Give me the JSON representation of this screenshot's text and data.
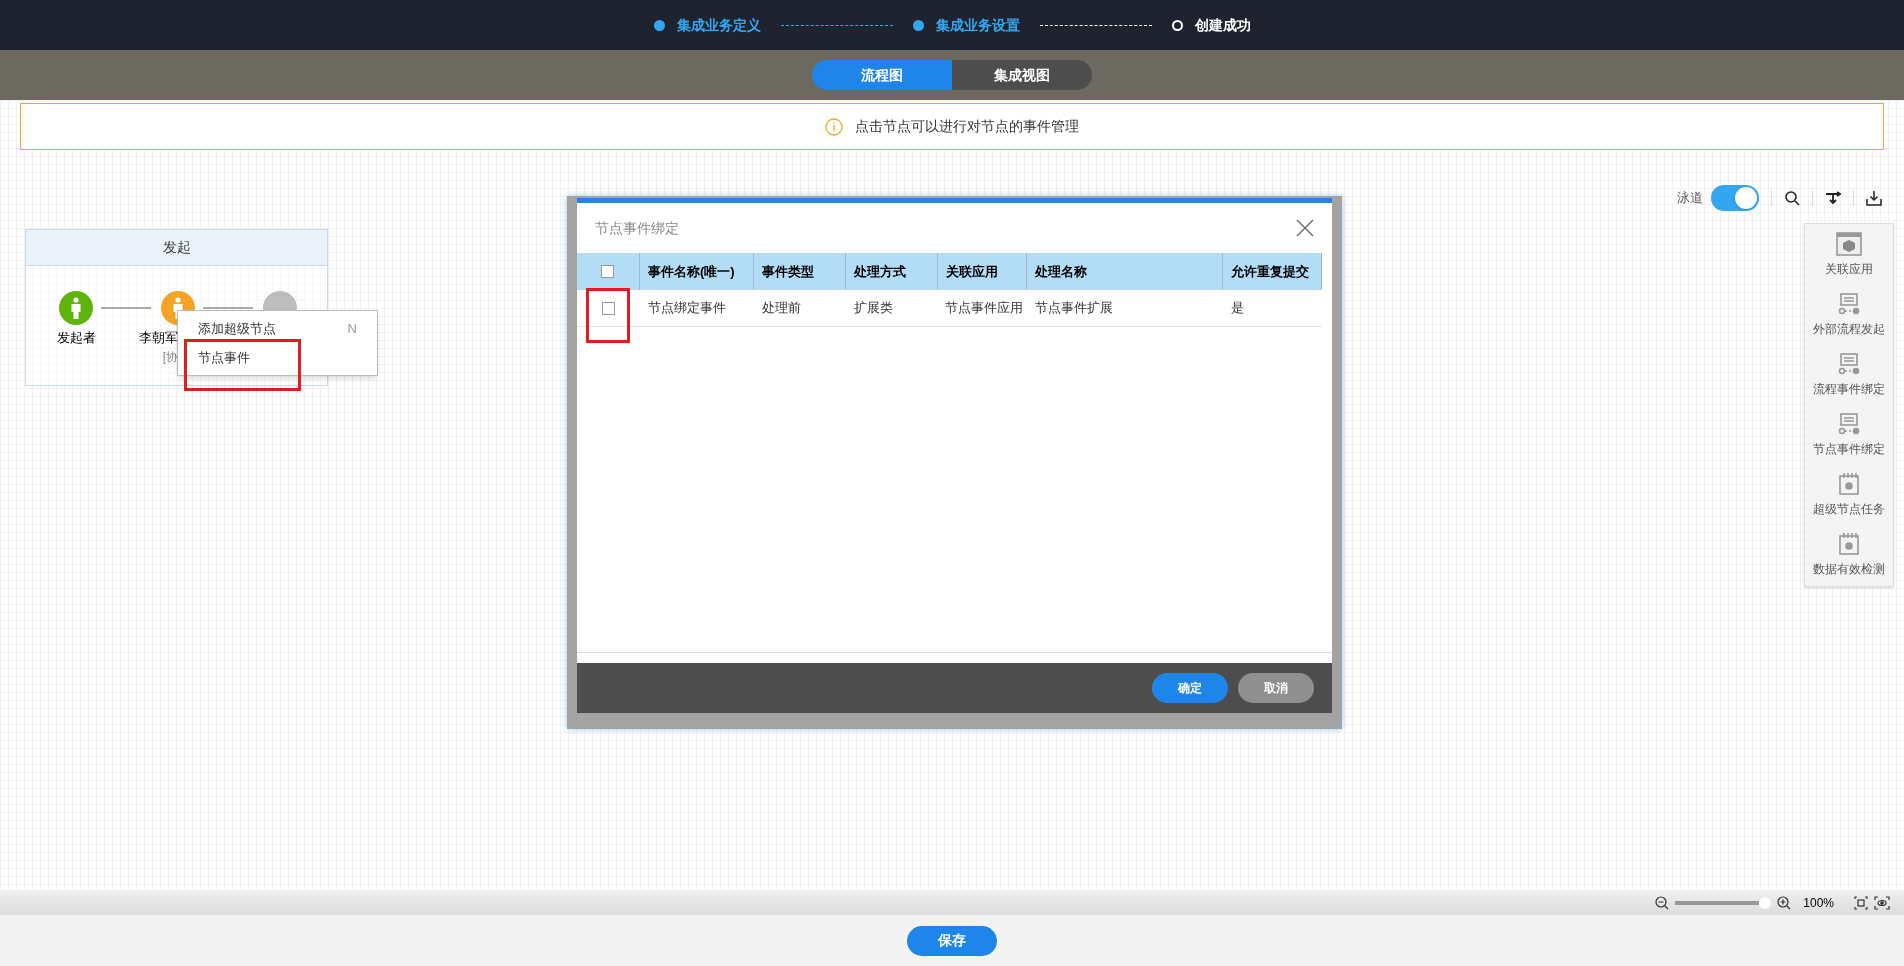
{
  "steps": [
    {
      "label": "集成业务定义",
      "reached": true
    },
    {
      "label": "集成业务设置",
      "reached": true
    },
    {
      "label": "创建成功",
      "reached": false
    }
  ],
  "view_tabs": [
    {
      "label": "流程图",
      "selected": true
    },
    {
      "label": "集成视图",
      "selected": false
    }
  ],
  "notice": "点击节点可以进行对节点的事件管理",
  "swimlane": {
    "title": "发起",
    "nodes": [
      {
        "kind": "start",
        "label": "发起者"
      },
      {
        "kind": "task",
        "label": "李朝军",
        "sublabel": "[协"
      },
      {
        "kind": "end"
      }
    ]
  },
  "context_menu": {
    "items": [
      {
        "label": "添加超级节点",
        "shortcut": "N"
      },
      {
        "label": "节点事件"
      }
    ]
  },
  "toolbar": {
    "lane_label": "泳道",
    "lane_on": true
  },
  "side_panel": [
    {
      "kind": "app",
      "label": "关联应用"
    },
    {
      "kind": "flow",
      "label": "外部流程发起"
    },
    {
      "kind": "flow",
      "label": "流程事件绑定"
    },
    {
      "kind": "flow",
      "label": "节点事件绑定"
    },
    {
      "kind": "calendar",
      "label": "超级节点任务"
    },
    {
      "kind": "calendar",
      "label": "数据有效检测"
    }
  ],
  "dialog": {
    "title": "节点事件绑定",
    "header_checked": false,
    "columns": [
      "事件名称(唯一)",
      "事件类型",
      "处理方式",
      "关联应用",
      "处理名称",
      "允许重复提交"
    ],
    "rows": [
      {
        "checked": false,
        "cells": [
          "节点绑定事件",
          "处理前",
          "扩展类",
          "节点事件应用",
          "节点事件扩展",
          "是"
        ]
      }
    ],
    "buttons": [
      {
        "kind": "primary",
        "label": "确定"
      },
      {
        "kind": "secondary",
        "label": "取消"
      }
    ]
  },
  "zoom": {
    "level": 1,
    "reading": "100%"
  },
  "save_button": "保存"
}
